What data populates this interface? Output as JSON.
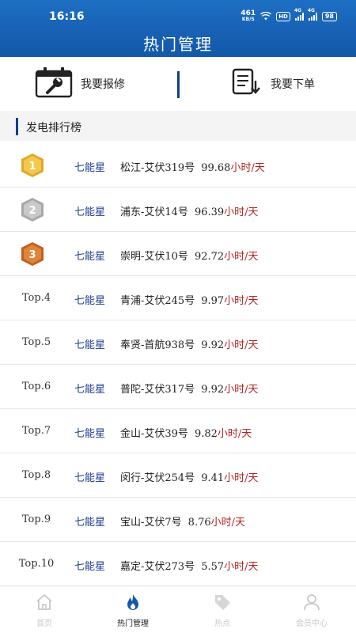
{
  "status_bar": {
    "time": "16:16",
    "net_speed_value": "461",
    "net_speed_unit": "KB/S",
    "hd_label": "HD",
    "signal1_label": "4G",
    "signal2_label": "4G",
    "battery": "98"
  },
  "header": {
    "title": "热门管理"
  },
  "actions": {
    "repair_label": "我要报修",
    "order_label": "我要下单"
  },
  "section": {
    "title": "发电排行榜"
  },
  "colors": {
    "header_blue": "#1760b3",
    "accent_navy": "#0f3f86",
    "unit_red": "#b0231f",
    "gold": "#f2c94c",
    "silver": "#c9c9c9",
    "bronze": "#e0843a"
  },
  "ranking": [
    {
      "rank": "",
      "medal": "gold-medal",
      "medal_num": "1",
      "company": "七能星",
      "station": "松江-艾伏319号",
      "value": "99.68",
      "unit": "小时/天"
    },
    {
      "rank": "",
      "medal": "silver-medal",
      "medal_num": "2",
      "company": "七能星",
      "station": "浦东-艾伏14号",
      "value": "96.39",
      "unit": "小时/天"
    },
    {
      "rank": "",
      "medal": "bronze-medal",
      "medal_num": "3",
      "company": "七能星",
      "station": "崇明-艾伏10号",
      "value": "92.72",
      "unit": "小时/天"
    },
    {
      "rank": "Top.4",
      "company": "七能星",
      "station": "青浦-艾伏245号",
      "value": "9.97",
      "unit": "小时/天"
    },
    {
      "rank": "Top.5",
      "company": "七能星",
      "station": "奉贤-首航938号",
      "value": "9.92",
      "unit": "小时/天"
    },
    {
      "rank": "Top.6",
      "company": "七能星",
      "station": "普陀-艾伏317号",
      "value": "9.92",
      "unit": "小时/天"
    },
    {
      "rank": "Top.7",
      "company": "七能星",
      "station": "金山-艾伏39号",
      "value": "9.82",
      "unit": "小时/天"
    },
    {
      "rank": "Top.8",
      "company": "七能星",
      "station": "闵行-艾伏254号",
      "value": "9.41",
      "unit": "小时/天"
    },
    {
      "rank": "Top.9",
      "company": "七能星",
      "station": "宝山-艾伏7号",
      "value": "8.76",
      "unit": "小时/天"
    },
    {
      "rank": "Top.10",
      "company": "七能星",
      "station": "嘉定-艾伏273号",
      "value": "5.57",
      "unit": "小时/天"
    }
  ],
  "tabbar": {
    "tabs": [
      {
        "label": "首页",
        "icon": "home-icon"
      },
      {
        "label": "热门管理",
        "icon": "flame-icon"
      },
      {
        "label": "热点",
        "icon": "tag-icon"
      },
      {
        "label": "会员中心",
        "icon": "user-icon"
      }
    ]
  }
}
